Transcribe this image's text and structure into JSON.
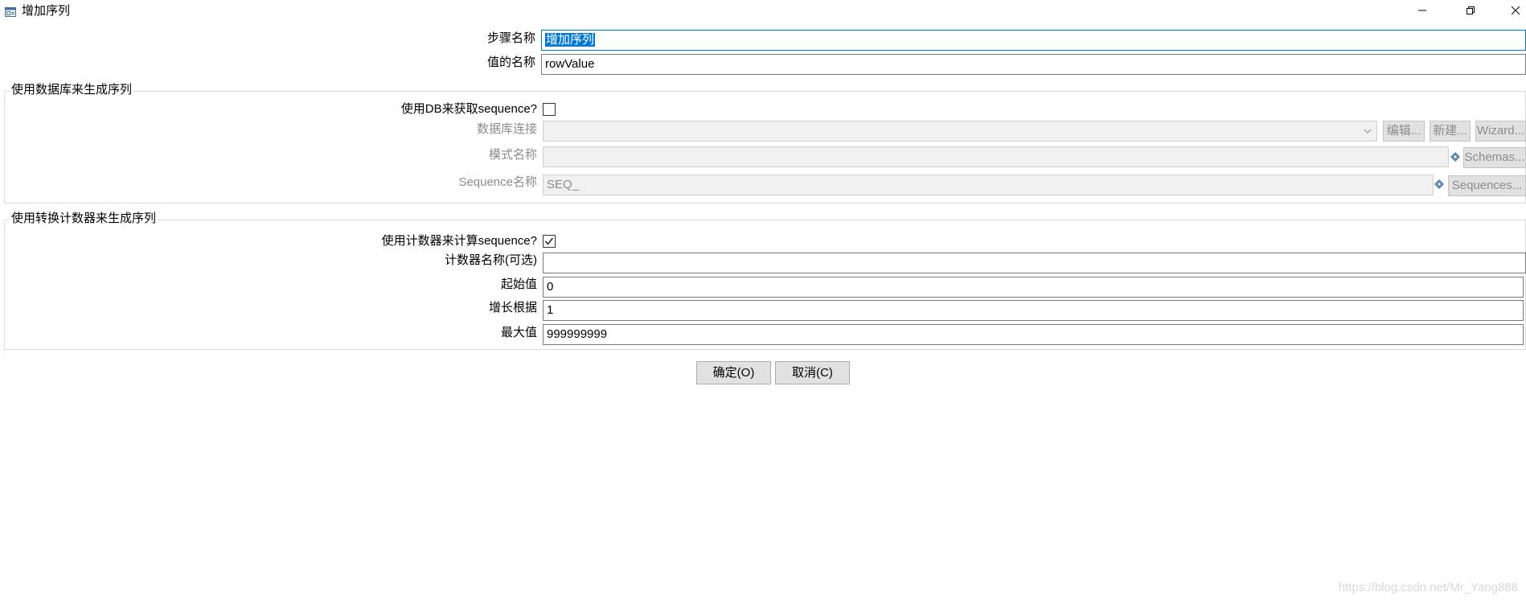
{
  "window": {
    "title": "增加序列",
    "icon": "dialog-window-icon",
    "controls": [
      "minimize-icon",
      "restore-icon",
      "close-icon"
    ]
  },
  "fields": {
    "step_name_label": "步骤名称",
    "step_name_value": "增加序列",
    "value_name_label": "值的名称",
    "value_name_value": "rowValue"
  },
  "db_group": {
    "title": "使用数据库来生成序列",
    "use_db_label": "使用DB来获取sequence?",
    "use_db_checked": false,
    "connection_label": "数据库连接",
    "connection_value": "",
    "edit_button": "编辑...",
    "new_button": "新建...",
    "wizard_button": "Wizard...",
    "schema_label": "模式名称",
    "schema_value": "",
    "schemas_button": "Schemas...",
    "sequence_label": "Sequence名称",
    "sequence_value": "SEQ_",
    "sequences_button": "Sequences..."
  },
  "counter_group": {
    "title": "使用转换计数器来生成序列",
    "use_counter_label": "使用计数器来计算sequence?",
    "use_counter_checked": true,
    "counter_name_label": "计数器名称(可选)",
    "counter_name_value": "",
    "start_label": "起始值",
    "start_value": "0",
    "increment_label": "增长根据",
    "increment_value": "1",
    "max_label": "最大值",
    "max_value": "999999999"
  },
  "buttons": {
    "ok": "确定(O)",
    "cancel": "取消(C)"
  },
  "watermark": "https://blog.csdn.net/Mr_Yang888"
}
